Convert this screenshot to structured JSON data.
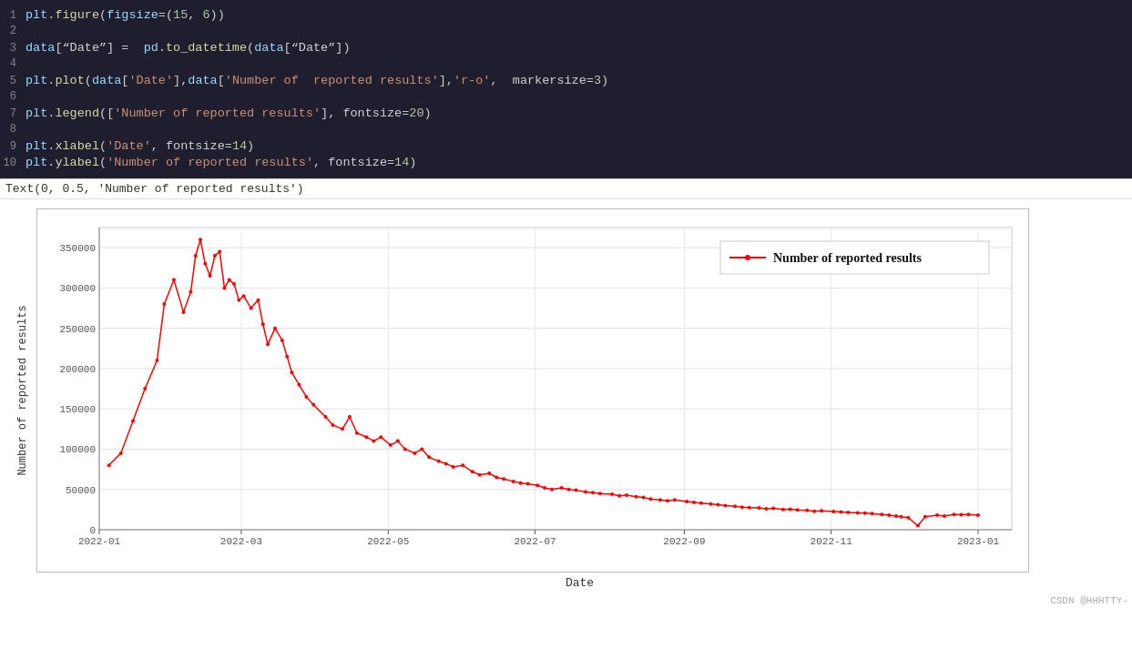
{
  "code": {
    "lines": [
      {
        "num": 1,
        "tokens": [
          {
            "text": "plt",
            "cls": "c-cyan"
          },
          {
            "text": ".",
            "cls": "c-plain"
          },
          {
            "text": "figure",
            "cls": "c-yellow"
          },
          {
            "text": "(",
            "cls": "c-plain"
          },
          {
            "text": "figsize",
            "cls": "c-cyan"
          },
          {
            "text": "=(",
            "cls": "c-plain"
          },
          {
            "text": "15",
            "cls": "c-num"
          },
          {
            "text": ", ",
            "cls": "c-plain"
          },
          {
            "text": "6",
            "cls": "c-num"
          },
          {
            "text": "))",
            "cls": "c-plain"
          }
        ]
      },
      {
        "num": 2,
        "tokens": []
      },
      {
        "num": 3,
        "tokens": [
          {
            "text": "data",
            "cls": "c-cyan"
          },
          {
            "text": "[“Date”] = ",
            "cls": "c-plain"
          },
          {
            "text": " pd",
            "cls": "c-cyan"
          },
          {
            "text": ".",
            "cls": "c-plain"
          },
          {
            "text": "to_datetime",
            "cls": "c-yellow"
          },
          {
            "text": "(",
            "cls": "c-plain"
          },
          {
            "text": "data",
            "cls": "c-cyan"
          },
          {
            "text": "[“Date”])",
            "cls": "c-plain"
          }
        ]
      },
      {
        "num": 4,
        "tokens": []
      },
      {
        "num": 5,
        "tokens": [
          {
            "text": "plt",
            "cls": "c-cyan"
          },
          {
            "text": ".",
            "cls": "c-plain"
          },
          {
            "text": "plot",
            "cls": "c-yellow"
          },
          {
            "text": "(",
            "cls": "c-plain"
          },
          {
            "text": "data",
            "cls": "c-cyan"
          },
          {
            "text": "[",
            "cls": "c-plain"
          },
          {
            "text": "'Date'",
            "cls": "c-orange"
          },
          {
            "text": "]",
            "cls": "c-plain"
          },
          {
            "text": ",",
            "cls": "c-plain"
          },
          {
            "text": "data",
            "cls": "c-cyan"
          },
          {
            "text": "[",
            "cls": "c-plain"
          },
          {
            "text": "'Number of  reported results'",
            "cls": "c-orange"
          },
          {
            "text": "]",
            "cls": "c-plain"
          },
          {
            "text": ",",
            "cls": "c-plain"
          },
          {
            "text": "'r-o'",
            "cls": "c-orange"
          },
          {
            "text": ",  markersize=",
            "cls": "c-plain"
          },
          {
            "text": "3",
            "cls": "c-num"
          },
          {
            "text": ")",
            "cls": "c-plain"
          }
        ]
      },
      {
        "num": 6,
        "tokens": []
      },
      {
        "num": 7,
        "tokens": [
          {
            "text": "plt",
            "cls": "c-cyan"
          },
          {
            "text": ".",
            "cls": "c-plain"
          },
          {
            "text": "legend",
            "cls": "c-yellow"
          },
          {
            "text": "([",
            "cls": "c-plain"
          },
          {
            "text": "'Number of reported results'",
            "cls": "c-orange"
          },
          {
            "text": "], fontsize=",
            "cls": "c-plain"
          },
          {
            "text": "20",
            "cls": "c-num"
          },
          {
            "text": ")",
            "cls": "c-plain"
          }
        ]
      },
      {
        "num": 8,
        "tokens": []
      },
      {
        "num": 9,
        "tokens": [
          {
            "text": "plt",
            "cls": "c-cyan"
          },
          {
            "text": ".",
            "cls": "c-plain"
          },
          {
            "text": "xlabel",
            "cls": "c-yellow"
          },
          {
            "text": "(",
            "cls": "c-plain"
          },
          {
            "text": "'Date'",
            "cls": "c-orange"
          },
          {
            "text": ", fontsize=",
            "cls": "c-plain"
          },
          {
            "text": "14",
            "cls": "c-num"
          },
          {
            "text": ")",
            "cls": "c-plain"
          }
        ]
      },
      {
        "num": 10,
        "tokens": [
          {
            "text": "plt",
            "cls": "c-cyan"
          },
          {
            "text": ".",
            "cls": "c-plain"
          },
          {
            "text": "ylabel",
            "cls": "c-yellow"
          },
          {
            "text": "(",
            "cls": "c-plain"
          },
          {
            "text": "'Number of reported results'",
            "cls": "c-orange"
          },
          {
            "text": ", fontsize=",
            "cls": "c-plain"
          },
          {
            "text": "14",
            "cls": "c-num"
          },
          {
            "text": ")",
            "cls": "c-plain"
          }
        ]
      }
    ]
  },
  "output_text": "Text(0, 0.5, 'Number of reported results')",
  "chart": {
    "y_label": "Number of reported results",
    "x_label": "Date",
    "legend_label": "Number of reported results",
    "y_ticks": [
      "0",
      "50000",
      "100000",
      "150000",
      "200000",
      "250000",
      "300000",
      "350000"
    ],
    "x_ticks": [
      "2022-01",
      "2022-03",
      "2022-05",
      "2022-07",
      "2022-09",
      "2022-11",
      "2023-01"
    ]
  },
  "watermark": "CSDN @HHHTTY-"
}
